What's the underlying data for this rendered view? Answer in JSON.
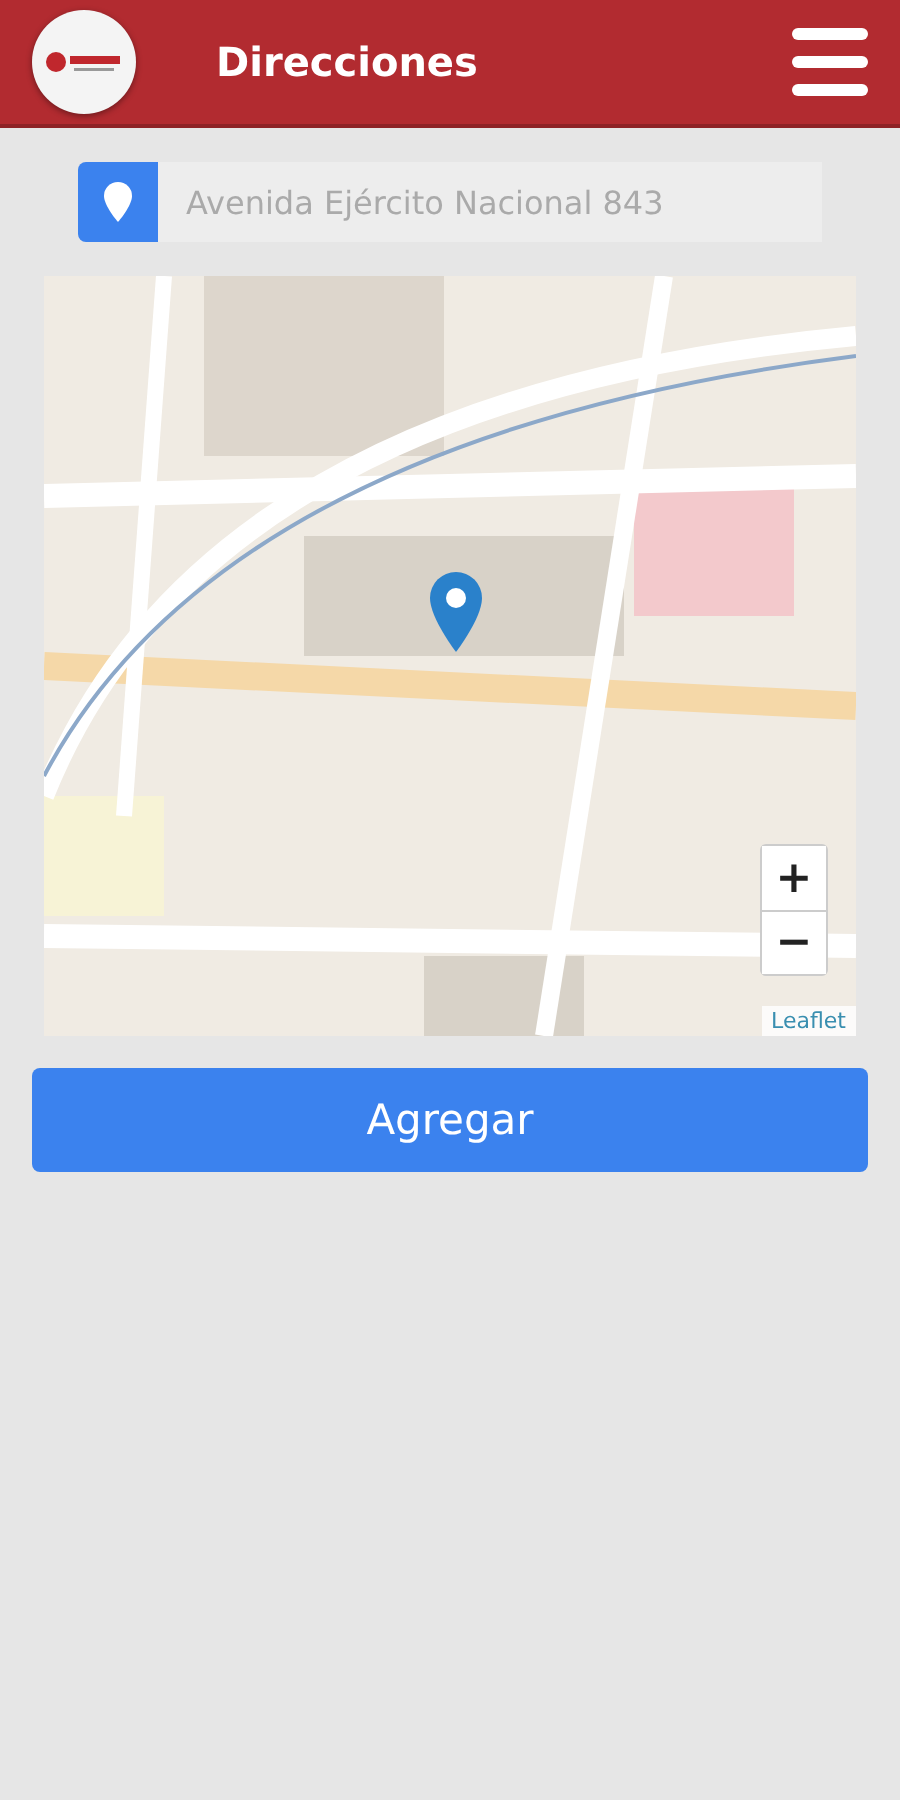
{
  "header": {
    "title": "Direcciones"
  },
  "address_field": {
    "placeholder": "Avenida Ejército Nacional 843"
  },
  "map": {
    "zoom_in": "+",
    "zoom_out": "−",
    "attribution": "Leaflet"
  },
  "add_button": {
    "label": "Agregar"
  }
}
